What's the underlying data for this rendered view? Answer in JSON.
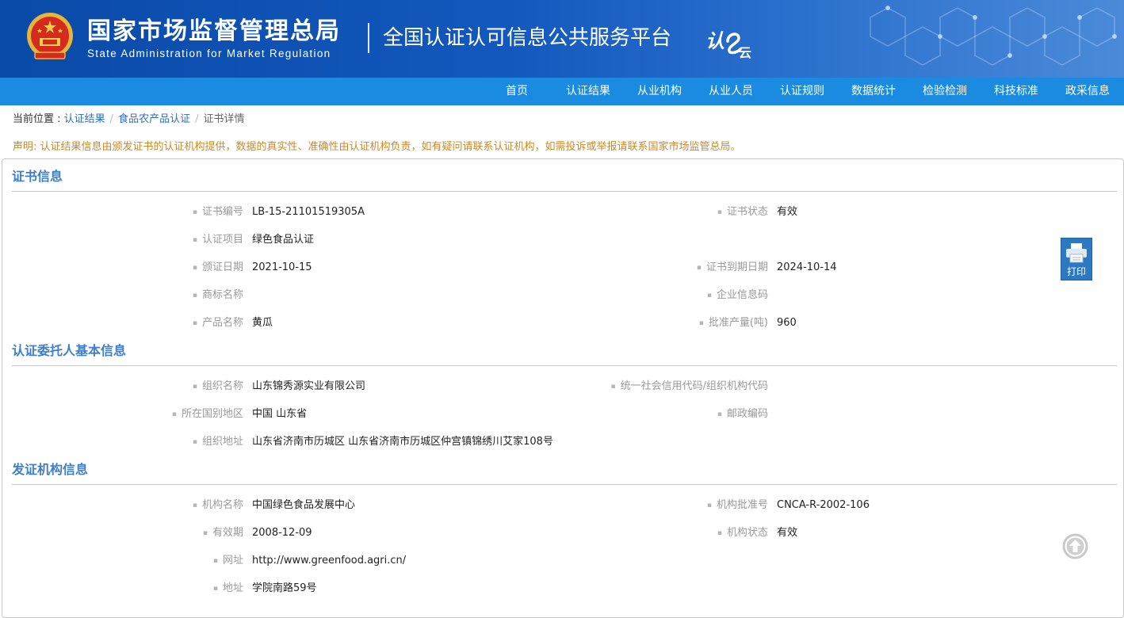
{
  "header": {
    "gov_name": "国家市场监督管理总局",
    "gov_name_en": "State Administration  for  Market Regulation",
    "platform_name": "全国认证认可信息公共服务平台",
    "logo_text": "认e云"
  },
  "nav": {
    "items": [
      {
        "label": "首页"
      },
      {
        "label": "认证结果"
      },
      {
        "label": "从业机构"
      },
      {
        "label": "从业人员"
      },
      {
        "label": "认证规则"
      },
      {
        "label": "数据统计"
      },
      {
        "label": "检验检测"
      },
      {
        "label": "科技标准"
      },
      {
        "label": "政采信息"
      }
    ]
  },
  "breadcrumb": {
    "prefix": "当前位置 : ",
    "items": [
      "认证结果",
      "食品农产品认证"
    ],
    "current": "证书详情"
  },
  "notice": "声明: 认证结果信息由颁发证书的认证机构提供，数据的真实性、准确性由认证机构负责，如有疑问请联系认证机构，如需投诉或举报请联系国家市场监管总局。",
  "sections": [
    {
      "title": "证书信息",
      "fields": [
        {
          "label": "证书编号",
          "value": "LB-15-21101519305A"
        },
        {
          "label": "证书状态",
          "value": "有效"
        },
        {
          "label": "认证项目",
          "value": "绿色食品认证"
        },
        {
          "label": "颁证日期",
          "value": "2021-10-15"
        },
        {
          "label": "证书到期日期",
          "value": "2024-10-14"
        },
        {
          "label": "商标名称",
          "value": ""
        },
        {
          "label": "企业信息码",
          "value": ""
        },
        {
          "label": "产品名称",
          "value": "黄瓜"
        },
        {
          "label": "批准产量(吨)",
          "value": "960"
        }
      ]
    },
    {
      "title": "认证委托人基本信息",
      "fields": [
        {
          "label": "组织名称",
          "value": "山东锦秀源实业有限公司"
        },
        {
          "label": "统一社会信用代码/组织机构代码",
          "value": ""
        },
        {
          "label": "所在国别地区",
          "value": "中国 山东省"
        },
        {
          "label": "邮政编码",
          "value": ""
        },
        {
          "label": "组织地址",
          "value": "山东省济南市历城区 山东省济南市历城区仲宫镇锦绣川艾家108号"
        }
      ]
    },
    {
      "title": "发证机构信息",
      "fields": [
        {
          "label": "机构名称",
          "value": "中国绿色食品发展中心"
        },
        {
          "label": "机构批准号",
          "value": "CNCA-R-2002-106"
        },
        {
          "label": "有效期",
          "value": "2008-12-09"
        },
        {
          "label": "机构状态",
          "value": "有效"
        },
        {
          "label": "网址",
          "value": "http://www.greenfood.agri.cn/"
        },
        {
          "label": "地址",
          "value": "学院南路59号"
        }
      ]
    }
  ],
  "print_button": {
    "label": "打印",
    "icon": "printer-icon"
  },
  "back_to_top": {
    "icon": "arrow-up-circle-icon"
  },
  "colors": {
    "header_blue": "#0a4aa8",
    "nav_blue": "#1a8be0",
    "section_title": "#3f7ec8",
    "notice": "#c9892a",
    "link": "#2d6fb6"
  }
}
